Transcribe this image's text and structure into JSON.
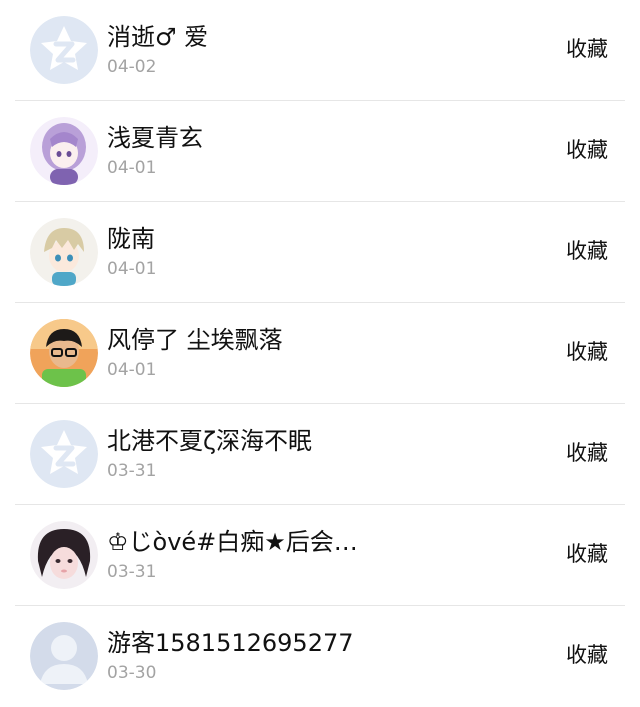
{
  "items": [
    {
      "name": "消逝♂ 爱",
      "date": "04-02",
      "action": "收藏",
      "avatar": "default-star-avatar"
    },
    {
      "name": "浅夏青玄",
      "date": "04-01",
      "action": "收藏",
      "avatar": "purple-anime-girl-avatar"
    },
    {
      "name": "陇南",
      "date": "04-01",
      "action": "收藏",
      "avatar": "blond-anime-boy-avatar"
    },
    {
      "name": "风停了 尘埃飘落",
      "date": "04-01",
      "action": "收藏",
      "avatar": "glasses-boy-photo-avatar"
    },
    {
      "name": "北港不夏ζ深海不眠",
      "date": "03-31",
      "action": "收藏",
      "avatar": "default-star-avatar"
    },
    {
      "name": "♔じòvé#白痴★后会…",
      "date": "03-31",
      "action": "收藏",
      "avatar": "girl-photo-avatar"
    },
    {
      "name": "游客1581512695277",
      "date": "03-30",
      "action": "收藏",
      "avatar": "guest-silhouette-avatar"
    }
  ]
}
